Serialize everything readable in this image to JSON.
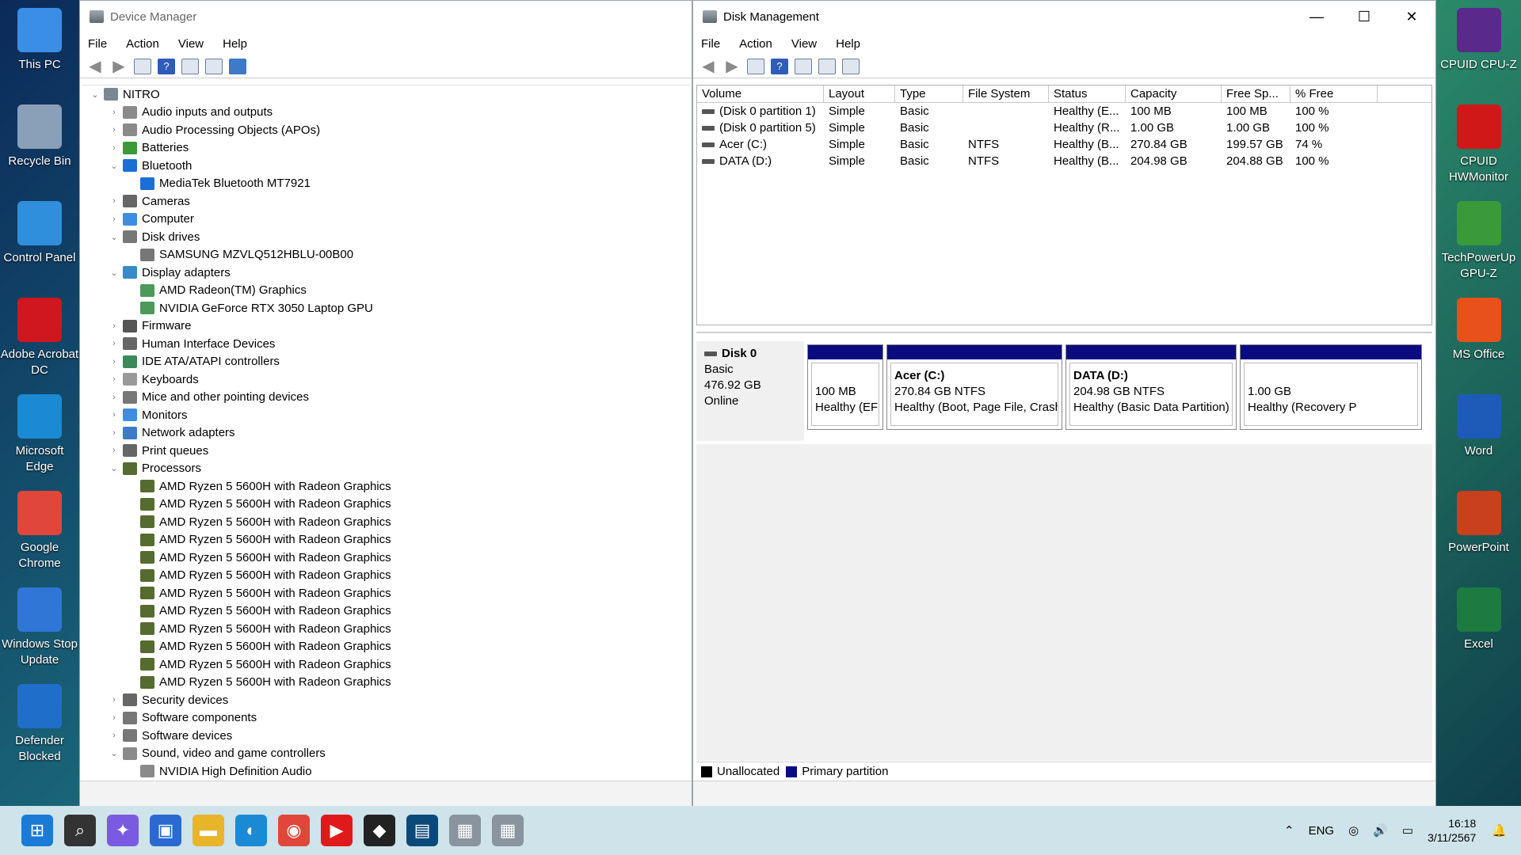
{
  "desktop": {
    "left_icons": [
      {
        "label": "This PC",
        "icon": "pc-icon",
        "color": "#3a8ee6"
      },
      {
        "label": "Recycle Bin",
        "icon": "recycle-bin-icon",
        "color": "#8aa0b8"
      },
      {
        "label": "Control Panel",
        "icon": "control-panel-icon",
        "color": "#2f8fdc"
      },
      {
        "label": "Adobe Acrobat DC",
        "icon": "acrobat-icon",
        "color": "#d0161e"
      },
      {
        "label": "Microsoft Edge",
        "icon": "edge-icon",
        "color": "#1b8ad4"
      },
      {
        "label": "Google Chrome",
        "icon": "chrome-icon",
        "color": "#e0463a"
      },
      {
        "label": "Windows Stop Update",
        "icon": "windows-stop-update-icon",
        "color": "#2f76d6"
      },
      {
        "label": "Defender Blocked",
        "icon": "defender-icon",
        "color": "#1f6fc9"
      }
    ],
    "right_icons": [
      {
        "label": "CPUID CPU-Z",
        "icon": "cpuz-icon",
        "color": "#5a2a8a"
      },
      {
        "label": "CPUID HWMonitor",
        "icon": "hwmonitor-icon",
        "color": "#d01818"
      },
      {
        "label": "TechPowerUp GPU-Z",
        "icon": "gpuz-icon",
        "color": "#3a9a3a"
      },
      {
        "label": "MS Office",
        "icon": "office-icon",
        "color": "#e8501c"
      },
      {
        "label": "Word",
        "icon": "word-icon",
        "color": "#1e5bb8"
      },
      {
        "label": "PowerPoint",
        "icon": "powerpoint-icon",
        "color": "#c8401c"
      },
      {
        "label": "Excel",
        "icon": "excel-icon",
        "color": "#1d7a40"
      }
    ]
  },
  "device_manager": {
    "title": "Device Manager",
    "menu": [
      "File",
      "Action",
      "View",
      "Help"
    ],
    "root": "NITRO",
    "tree": [
      {
        "label": "Audio inputs and outputs",
        "level": 1,
        "state": "collapsed",
        "color": "#8a8a8a"
      },
      {
        "label": "Audio Processing Objects (APOs)",
        "level": 1,
        "state": "collapsed",
        "color": "#8a8a8a"
      },
      {
        "label": "Batteries",
        "level": 1,
        "state": "collapsed",
        "color": "#3a9a3a"
      },
      {
        "label": "Bluetooth",
        "level": 1,
        "state": "expanded",
        "color": "#1a6fd6"
      },
      {
        "label": "MediaTek Bluetooth MT7921",
        "level": 2,
        "state": "leaf",
        "color": "#1a6fd6"
      },
      {
        "label": "Cameras",
        "level": 1,
        "state": "collapsed",
        "color": "#666666"
      },
      {
        "label": "Computer",
        "level": 1,
        "state": "collapsed",
        "color": "#3d8ee0"
      },
      {
        "label": "Disk drives",
        "level": 1,
        "state": "expanded",
        "color": "#777777"
      },
      {
        "label": "SAMSUNG MZVLQ512HBLU-00B00",
        "level": 2,
        "state": "leaf",
        "color": "#777777"
      },
      {
        "label": "Display adapters",
        "level": 1,
        "state": "expanded",
        "color": "#3a8ac8"
      },
      {
        "label": "AMD Radeon(TM) Graphics",
        "level": 2,
        "state": "leaf",
        "color": "#4a9a5a"
      },
      {
        "label": "NVIDIA GeForce RTX 3050 Laptop GPU",
        "level": 2,
        "state": "leaf",
        "color": "#4a9a5a"
      },
      {
        "label": "Firmware",
        "level": 1,
        "state": "collapsed",
        "color": "#555555"
      },
      {
        "label": "Human Interface Devices",
        "level": 1,
        "state": "collapsed",
        "color": "#666666"
      },
      {
        "label": "IDE ATA/ATAPI controllers",
        "level": 1,
        "state": "collapsed",
        "color": "#3a8a5a"
      },
      {
        "label": "Keyboards",
        "level": 1,
        "state": "collapsed",
        "color": "#999999"
      },
      {
        "label": "Mice and other pointing devices",
        "level": 1,
        "state": "collapsed",
        "color": "#777777"
      },
      {
        "label": "Monitors",
        "level": 1,
        "state": "collapsed",
        "color": "#3d8ee0"
      },
      {
        "label": "Network adapters",
        "level": 1,
        "state": "collapsed",
        "color": "#3d7ac7"
      },
      {
        "label": "Print queues",
        "level": 1,
        "state": "collapsed",
        "color": "#666666"
      },
      {
        "label": "Processors",
        "level": 1,
        "state": "expanded",
        "color": "#556b2f"
      },
      {
        "label": "AMD Ryzen 5 5600H with Radeon Graphics",
        "level": 2,
        "state": "leaf",
        "color": "#556b2f"
      },
      {
        "label": "AMD Ryzen 5 5600H with Radeon Graphics",
        "level": 2,
        "state": "leaf",
        "color": "#556b2f"
      },
      {
        "label": "AMD Ryzen 5 5600H with Radeon Graphics",
        "level": 2,
        "state": "leaf",
        "color": "#556b2f"
      },
      {
        "label": "AMD Ryzen 5 5600H with Radeon Graphics",
        "level": 2,
        "state": "leaf",
        "color": "#556b2f"
      },
      {
        "label": "AMD Ryzen 5 5600H with Radeon Graphics",
        "level": 2,
        "state": "leaf",
        "color": "#556b2f"
      },
      {
        "label": "AMD Ryzen 5 5600H with Radeon Graphics",
        "level": 2,
        "state": "leaf",
        "color": "#556b2f"
      },
      {
        "label": "AMD Ryzen 5 5600H with Radeon Graphics",
        "level": 2,
        "state": "leaf",
        "color": "#556b2f"
      },
      {
        "label": "AMD Ryzen 5 5600H with Radeon Graphics",
        "level": 2,
        "state": "leaf",
        "color": "#556b2f"
      },
      {
        "label": "AMD Ryzen 5 5600H with Radeon Graphics",
        "level": 2,
        "state": "leaf",
        "color": "#556b2f"
      },
      {
        "label": "AMD Ryzen 5 5600H with Radeon Graphics",
        "level": 2,
        "state": "leaf",
        "color": "#556b2f"
      },
      {
        "label": "AMD Ryzen 5 5600H with Radeon Graphics",
        "level": 2,
        "state": "leaf",
        "color": "#556b2f"
      },
      {
        "label": "AMD Ryzen 5 5600H with Radeon Graphics",
        "level": 2,
        "state": "leaf",
        "color": "#556b2f"
      },
      {
        "label": "Security devices",
        "level": 1,
        "state": "collapsed",
        "color": "#666666"
      },
      {
        "label": "Software components",
        "level": 1,
        "state": "collapsed",
        "color": "#777777"
      },
      {
        "label": "Software devices",
        "level": 1,
        "state": "collapsed",
        "color": "#777777"
      },
      {
        "label": "Sound, video and game controllers",
        "level": 1,
        "state": "expanded",
        "color": "#8a8a8a"
      },
      {
        "label": "NVIDIA High Definition Audio",
        "level": 2,
        "state": "leaf",
        "color": "#8a8a8a"
      }
    ]
  },
  "disk_management": {
    "title": "Disk Management",
    "menu": [
      "File",
      "Action",
      "View",
      "Help"
    ],
    "columns": [
      "Volume",
      "Layout",
      "Type",
      "File System",
      "Status",
      "Capacity",
      "Free Sp...",
      "% Free"
    ],
    "rows": [
      [
        "(Disk 0 partition 1)",
        "Simple",
        "Basic",
        "",
        "Healthy (E...",
        "100 MB",
        "100 MB",
        "100 %"
      ],
      [
        "(Disk 0 partition 5)",
        "Simple",
        "Basic",
        "",
        "Healthy (R...",
        "1.00 GB",
        "1.00 GB",
        "100 %"
      ],
      [
        "Acer (C:)",
        "Simple",
        "Basic",
        "NTFS",
        "Healthy (B...",
        "270.84 GB",
        "199.57 GB",
        "74 %"
      ],
      [
        "DATA (D:)",
        "Simple",
        "Basic",
        "NTFS",
        "Healthy (B...",
        "204.98 GB",
        "204.88 GB",
        "100 %"
      ]
    ],
    "disk": {
      "name": "Disk 0",
      "type": "Basic",
      "size": "476.92 GB",
      "status": "Online"
    },
    "partitions": [
      {
        "name": "",
        "size": "100 MB",
        "status": "Healthy (EFI"
      },
      {
        "name": "Acer  (C:)",
        "size": "270.84 GB NTFS",
        "status": "Healthy (Boot, Page File, Crash Dump,"
      },
      {
        "name": "DATA  (D:)",
        "size": "204.98 GB NTFS",
        "status": "Healthy (Basic Data Partition)"
      },
      {
        "name": "",
        "size": "1.00 GB",
        "status": "Healthy (Recovery P"
      }
    ],
    "legend": [
      {
        "label": "Unallocated",
        "color": "#000000"
      },
      {
        "label": "Primary partition",
        "color": "#0b0b80"
      }
    ]
  },
  "taskbar": {
    "apps": [
      {
        "icon": "start-icon",
        "color": "#1a7ad6",
        "glyph": "⊞"
      },
      {
        "icon": "search-icon",
        "color": "#333333",
        "glyph": "⌕"
      },
      {
        "icon": "copilot-icon",
        "color": "#7a5ae0",
        "glyph": "✦"
      },
      {
        "icon": "store-icon",
        "color": "#2a6ad0",
        "glyph": "▣"
      },
      {
        "icon": "file-explorer-icon",
        "color": "#e8b42a",
        "glyph": "▬"
      },
      {
        "icon": "edge-icon",
        "color": "#1b8ad4",
        "glyph": "◐"
      },
      {
        "icon": "chrome-icon",
        "color": "#e0463a",
        "glyph": "◉"
      },
      {
        "icon": "youtube-icon",
        "color": "#e01a1a",
        "glyph": "▶"
      },
      {
        "icon": "dropbox-icon",
        "color": "#222222",
        "glyph": "◆"
      },
      {
        "icon": "hwinfo-icon",
        "color": "#0a4a7a",
        "glyph": "▤"
      },
      {
        "icon": "device-manager-icon",
        "color": "#8a949e",
        "glyph": "▦"
      },
      {
        "icon": "disk-management-icon",
        "color": "#8a949e",
        "glyph": "▦"
      }
    ],
    "language": "ENG",
    "time": "16:18",
    "date": "3/11/2567"
  }
}
